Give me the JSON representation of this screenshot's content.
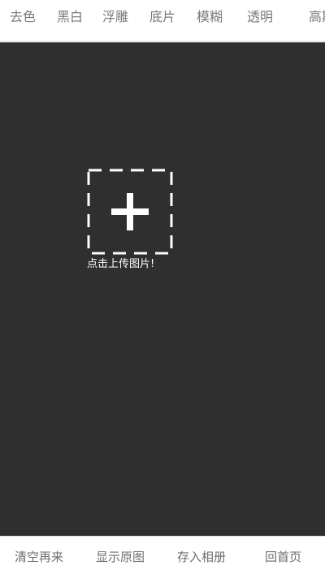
{
  "filters": {
    "items": [
      {
        "label": "去色"
      },
      {
        "label": "黑白"
      },
      {
        "label": "浮雕"
      },
      {
        "label": "底片"
      },
      {
        "label": "模糊"
      },
      {
        "label": "透明"
      },
      {
        "label": "高斯"
      }
    ]
  },
  "canvas": {
    "background": "#2f2f2f",
    "upload_icon": "plus-icon",
    "upload_label": "点击上传图片!"
  },
  "actions": {
    "items": [
      {
        "label": "清空再来"
      },
      {
        "label": "显示原图"
      },
      {
        "label": "存入相册"
      },
      {
        "label": "回首页"
      }
    ]
  }
}
